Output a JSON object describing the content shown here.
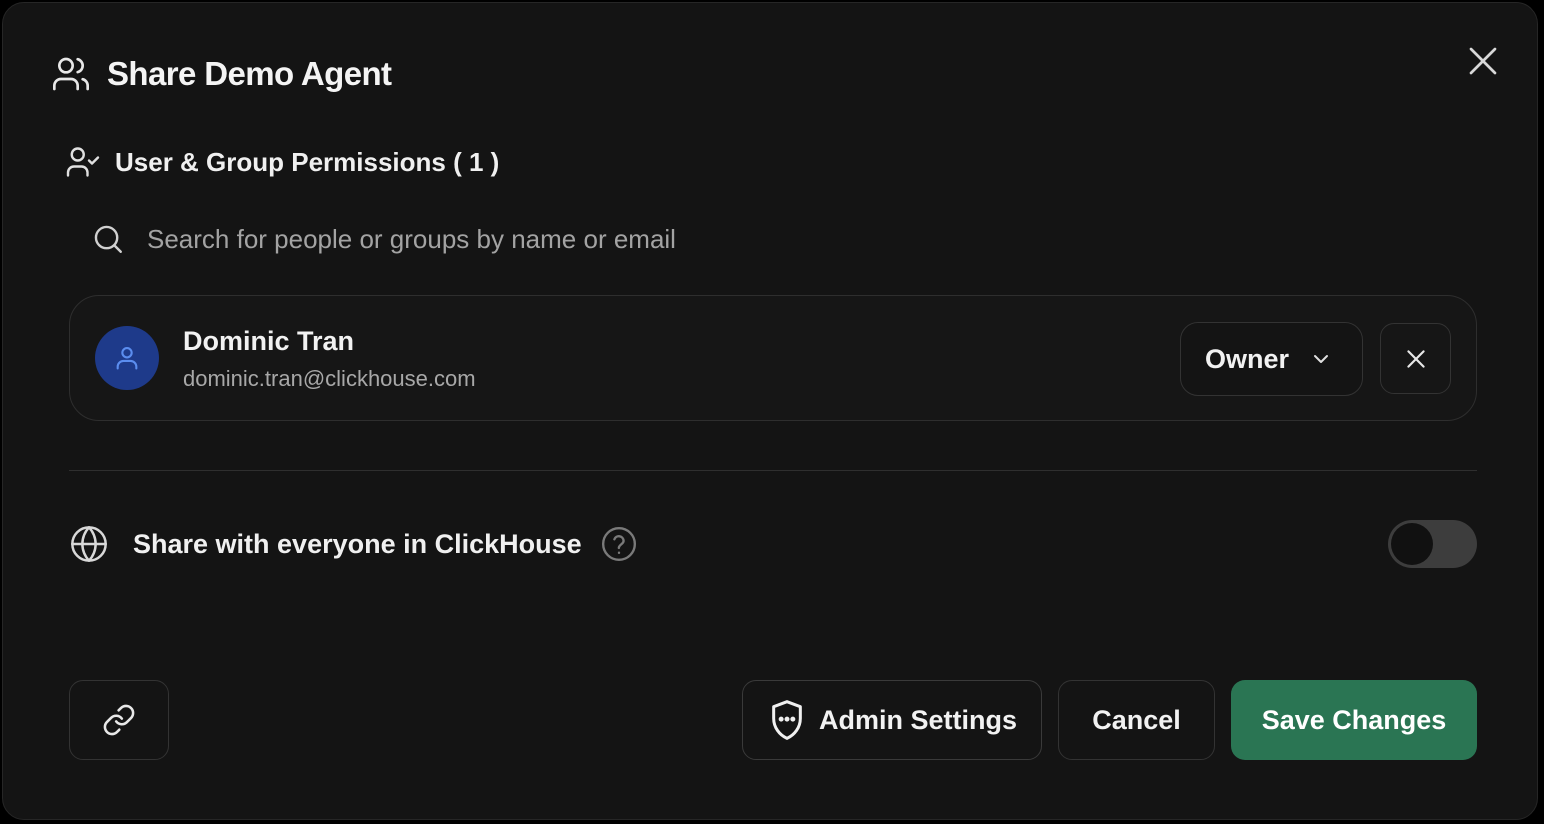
{
  "dialog": {
    "title": "Share Demo Agent",
    "close_label": "Close"
  },
  "permissions": {
    "heading": "User & Group Permissions ( 1 )"
  },
  "search": {
    "placeholder": "Search for people or groups by name or email",
    "value": ""
  },
  "users": [
    {
      "name": "Dominic Tran",
      "email": "dominic.tran@clickhouse.com",
      "role": "Owner"
    }
  ],
  "share_everyone": {
    "label": "Share with everyone in ClickHouse",
    "enabled": false
  },
  "footer": {
    "admin_settings_label": "Admin Settings",
    "cancel_label": "Cancel",
    "save_label": "Save Changes"
  },
  "colors": {
    "background": "#141414",
    "accent_green": "#2a7553",
    "avatar_blue": "#1e3a8a",
    "avatar_icon": "#5b8def"
  },
  "icons": {
    "header": "users-icon",
    "section": "user-check-icon",
    "search": "search-icon",
    "close": "close-icon",
    "avatar": "user-icon",
    "role_dropdown": "chevron-down-icon",
    "remove": "x-icon",
    "globe": "globe-icon",
    "help": "help-circle-icon",
    "link": "link-icon",
    "admin": "shield-icon"
  }
}
